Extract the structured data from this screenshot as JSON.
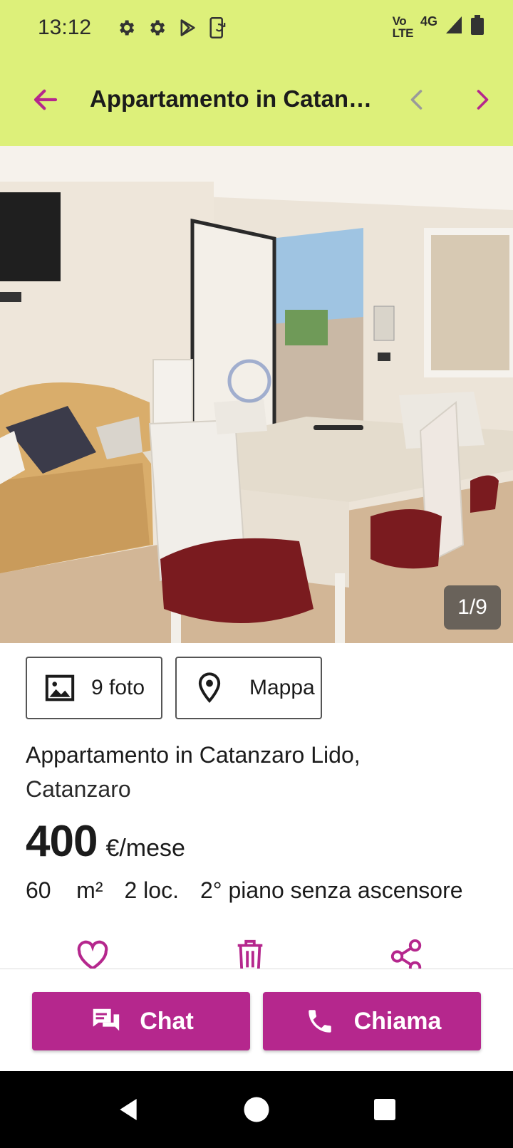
{
  "status_bar": {
    "time": "13:12",
    "volte_top": "Vo",
    "volte_bottom": "LTE",
    "network": "4G",
    "icons": [
      "gear-icon",
      "gear-icon",
      "play-store-icon",
      "phone-sync-icon",
      "signal-icon",
      "battery-icon"
    ]
  },
  "app_bar": {
    "title": "Appartamento in Catanzaro Lido, Catanzaro",
    "back_icon": "arrow-left-icon",
    "prev_icon": "chevron-left-icon",
    "next_icon": "chevron-right-icon"
  },
  "gallery": {
    "counter": "1/9"
  },
  "chips": {
    "photos_label": "9 foto",
    "map_label": "Mappa"
  },
  "listing": {
    "title_line1": "Appartamento in Catanzaro Lido,",
    "title_line2": "Catanzaro",
    "price_value": "400",
    "price_unit": "€/mese",
    "area": "60",
    "area_unit": "m²",
    "rooms": "2 loc.",
    "floor": "2° piano senza ascensore"
  },
  "quick_actions": [
    "heart-icon",
    "trash-icon",
    "share-icon"
  ],
  "bottom_actions": {
    "chat_label": "Chat",
    "call_label": "Chiama"
  },
  "colors": {
    "header_bg": "#ddf07a",
    "accent": "#b5278d",
    "text": "#1b1b1b"
  }
}
